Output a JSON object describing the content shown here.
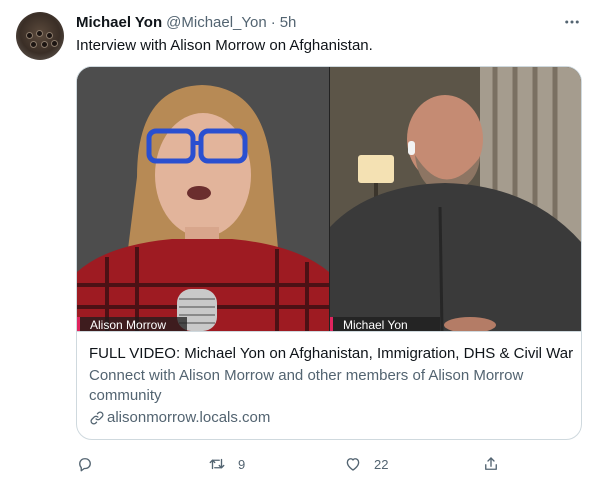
{
  "tweet": {
    "author_name": "Michael Yon",
    "author_handle": "@Michael_Yon",
    "separator": "·",
    "time": "5h",
    "text": "Interview with Alison Morrow on Afghanistan."
  },
  "card": {
    "left_speaker": "Alison Morrow",
    "right_speaker": "Michael Yon",
    "title": "FULL VIDEO: Michael Yon on Afghanistan, Immigration, DHS & Civil War",
    "description": "Connect with Alison Morrow and other members of Alison Morrow community",
    "link": "alisonmorrow.locals.com"
  },
  "actions": {
    "reply_count": "",
    "retweet_count": "9",
    "like_count": "22",
    "share_count": ""
  },
  "icons": {
    "more": "more-horizontal-icon",
    "reply": "reply-icon",
    "retweet": "retweet-icon",
    "like": "heart-icon",
    "share": "share-icon",
    "link": "link-icon"
  },
  "colors": {
    "text_primary": "#0f1419",
    "text_secondary": "#536471",
    "border": "#cfd9de",
    "name_tag_accent": "#e0245e"
  }
}
